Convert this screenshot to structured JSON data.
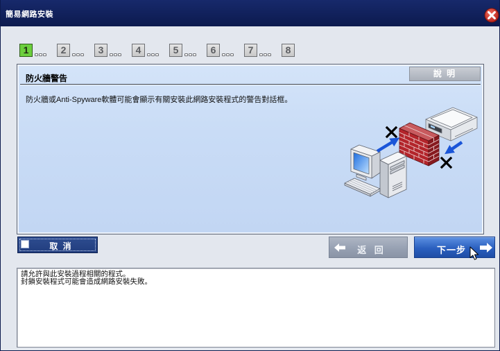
{
  "window": {
    "title": "簡易網路安裝",
    "close_icon": "close-icon"
  },
  "steps": [
    {
      "number": "1",
      "current": true
    },
    {
      "number": "2",
      "current": false
    },
    {
      "number": "3",
      "current": false
    },
    {
      "number": "4",
      "current": false
    },
    {
      "number": "5",
      "current": false
    },
    {
      "number": "6",
      "current": false
    },
    {
      "number": "7",
      "current": false
    },
    {
      "number": "8",
      "current": false
    }
  ],
  "panel": {
    "title": "防火牆警告",
    "help_label": "說 明",
    "message": "防火牆或Anti-Spyware軟體可能會顯示有關安裝此網路安裝程式的警告對話框。"
  },
  "illustration": {
    "icons": [
      "computer-icon",
      "keyboard-icon",
      "firewall-icon",
      "printer-icon",
      "blocked-icon",
      "arrow-icon"
    ]
  },
  "navigation": {
    "cancel_label": "取 消",
    "back_label": "返 回",
    "back_icon": "arrow-left-icon",
    "next_label": "下一步",
    "next_icon": "arrow-right-icon"
  },
  "info": {
    "lines": [
      "請允許與此安裝過程相關的程式。",
      "封鎖安裝程式可能會造成網路安裝失敗。"
    ]
  },
  "colors": {
    "title_bar": "#0c1a4e",
    "close": "#d6352b",
    "step_current": "#6ccf3d",
    "panel": "#c9dcf6",
    "cancel_button": "#213d7e",
    "back_button": "#97a1b3",
    "next_button": "#2a5fbf"
  }
}
